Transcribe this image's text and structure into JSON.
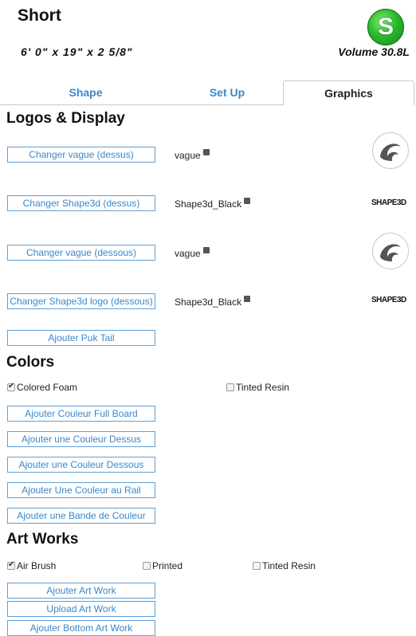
{
  "header": {
    "title": "Short",
    "dimensions": "6' 0\"  x 19\"  x  2 5/8\"",
    "volume": "Volume 30.8L",
    "logo_letter": "S"
  },
  "tabs": [
    {
      "label": "Shape",
      "active": false
    },
    {
      "label": "Set Up",
      "active": false
    },
    {
      "label": "Graphics",
      "active": true
    }
  ],
  "logos_section": {
    "title": "Logos & Display",
    "items": [
      {
        "button": "Changer vague (dessus)",
        "name": "vague",
        "preview": "wave-logo"
      },
      {
        "button": "Changer Shape3d (dessus)",
        "name": "Shape3d_Black",
        "preview": "SHAPE3D"
      },
      {
        "button": "Changer vague (dessous)",
        "name": "vague",
        "preview": "wave-logo"
      },
      {
        "button": "Changer Shape3d logo (dessous)",
        "name": "Shape3d_Black",
        "preview": "SHAPE3D"
      }
    ],
    "puk_button": "Ajouter Puk Tail"
  },
  "colors_section": {
    "title": "Colors",
    "checks": [
      {
        "label": "Colored Foam",
        "checked": true
      },
      {
        "label": "Tinted Resin",
        "checked": false
      }
    ],
    "buttons": [
      "Ajouter Couleur Full Board",
      "Ajouter une Couleur Dessus",
      "Ajouter une Couleur Dessous",
      "Ajouter Une Couleur au Rail",
      "Ajouter une Bande de Couleur"
    ]
  },
  "artworks_section": {
    "title": "Art Works",
    "checks": [
      {
        "label": "Air Brush",
        "checked": true
      },
      {
        "label": "Printed",
        "checked": false
      },
      {
        "label": "Tinted Resin",
        "checked": false
      }
    ],
    "buttons": [
      "Ajouter Art Work",
      "Upload Art Work",
      "Ajouter Bottom Art Work"
    ]
  },
  "colors": {
    "link": "#3a87c8",
    "brand_green": "#2dbb2d"
  }
}
